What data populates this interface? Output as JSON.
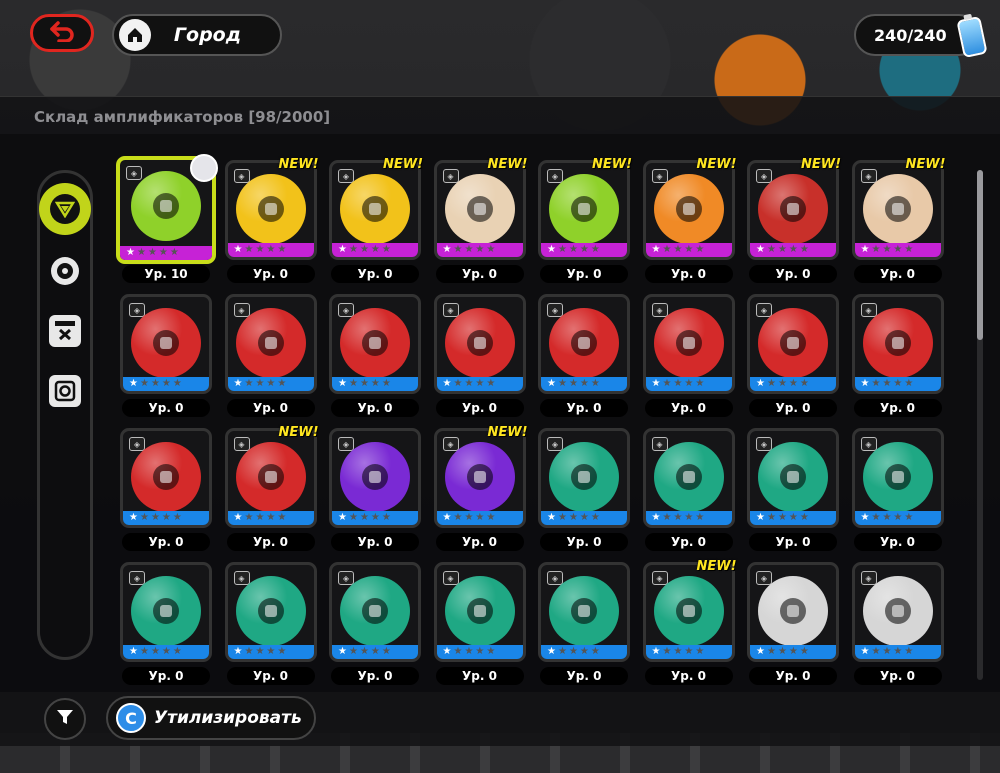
{
  "header": {
    "city_label": "Город",
    "energy": "240/240"
  },
  "panel": {
    "title": "Склад амплификаторов [98/2000]"
  },
  "side_tabs": [
    {
      "icon": "amplifier-tab-icon",
      "active": true
    },
    {
      "icon": "disc-tab-icon",
      "active": false
    },
    {
      "icon": "box-tab-icon",
      "active": false
    },
    {
      "icon": "safe-tab-icon",
      "active": false
    }
  ],
  "items": [
    {
      "level": "Ур. 10",
      "color": "#8fd12a",
      "strip": "purple",
      "stars": 1,
      "new": false,
      "selected": true
    },
    {
      "level": "Ур. 0",
      "color": "#f2c21a",
      "strip": "purple",
      "stars": 1,
      "new": true
    },
    {
      "level": "Ур. 0",
      "color": "#f2c21a",
      "strip": "purple",
      "stars": 1,
      "new": true
    },
    {
      "level": "Ур. 0",
      "color": "#e9d2b4",
      "strip": "purple",
      "stars": 1,
      "new": true
    },
    {
      "level": "Ур. 0",
      "color": "#8fd12a",
      "strip": "purple",
      "stars": 1,
      "new": true
    },
    {
      "level": "Ур. 0",
      "color": "#f08a26",
      "strip": "purple",
      "stars": 1,
      "new": true
    },
    {
      "level": "Ур. 0",
      "color": "#c8302a",
      "strip": "purple",
      "stars": 1,
      "new": true
    },
    {
      "level": "Ур. 0",
      "color": "#e8c9a8",
      "strip": "purple",
      "stars": 1,
      "new": true
    },
    {
      "level": "Ур. 0",
      "color": "#d42a2a",
      "strip": "blue",
      "stars": 1,
      "new": false
    },
    {
      "level": "Ур. 0",
      "color": "#d42a2a",
      "strip": "blue",
      "stars": 1,
      "new": false
    },
    {
      "level": "Ур. 0",
      "color": "#d42a2a",
      "strip": "blue",
      "stars": 1,
      "new": false
    },
    {
      "level": "Ур. 0",
      "color": "#d42a2a",
      "strip": "blue",
      "stars": 1,
      "new": false
    },
    {
      "level": "Ур. 0",
      "color": "#d42a2a",
      "strip": "blue",
      "stars": 1,
      "new": false
    },
    {
      "level": "Ур. 0",
      "color": "#d42a2a",
      "strip": "blue",
      "stars": 1,
      "new": false
    },
    {
      "level": "Ур. 0",
      "color": "#d42a2a",
      "strip": "blue",
      "stars": 1,
      "new": false
    },
    {
      "level": "Ур. 0",
      "color": "#d42a2a",
      "strip": "blue",
      "stars": 1,
      "new": false
    },
    {
      "level": "Ур. 0",
      "color": "#d42a2a",
      "strip": "blue",
      "stars": 1,
      "new": false
    },
    {
      "level": "Ур. 0",
      "color": "#d42a2a",
      "strip": "blue",
      "stars": 1,
      "new": true
    },
    {
      "level": "Ур. 0",
      "color": "#7a2ad4",
      "strip": "blue",
      "stars": 1,
      "new": false
    },
    {
      "level": "Ур. 0",
      "color": "#7a2ad4",
      "strip": "blue",
      "stars": 1,
      "new": true
    },
    {
      "level": "Ур. 0",
      "color": "#1fa884",
      "strip": "blue",
      "stars": 1,
      "new": false
    },
    {
      "level": "Ур. 0",
      "color": "#1fa884",
      "strip": "blue",
      "stars": 1,
      "new": false
    },
    {
      "level": "Ур. 0",
      "color": "#1fa884",
      "strip": "blue",
      "stars": 1,
      "new": false
    },
    {
      "level": "Ур. 0",
      "color": "#1fa884",
      "strip": "blue",
      "stars": 1,
      "new": false
    },
    {
      "level": "Ур. 0",
      "color": "#1fa884",
      "strip": "blue",
      "stars": 1,
      "new": false
    },
    {
      "level": "Ур. 0",
      "color": "#1fa884",
      "strip": "blue",
      "stars": 1,
      "new": false
    },
    {
      "level": "Ур. 0",
      "color": "#1fa884",
      "strip": "blue",
      "stars": 1,
      "new": false
    },
    {
      "level": "Ур. 0",
      "color": "#1fa884",
      "strip": "blue",
      "stars": 1,
      "new": false
    },
    {
      "level": "Ур. 0",
      "color": "#1fa884",
      "strip": "blue",
      "stars": 1,
      "new": false
    },
    {
      "level": "Ур. 0",
      "color": "#1fa884",
      "strip": "blue",
      "stars": 1,
      "new": true
    },
    {
      "level": "Ур. 0",
      "color": "#d6d6d6",
      "strip": "blue",
      "stars": 1,
      "new": false
    },
    {
      "level": "Ур. 0",
      "color": "#d6d6d6",
      "strip": "blue",
      "stars": 1,
      "new": false
    }
  ],
  "new_label": "NEW!",
  "footer": {
    "dismantle_label": "Утилизировать"
  }
}
